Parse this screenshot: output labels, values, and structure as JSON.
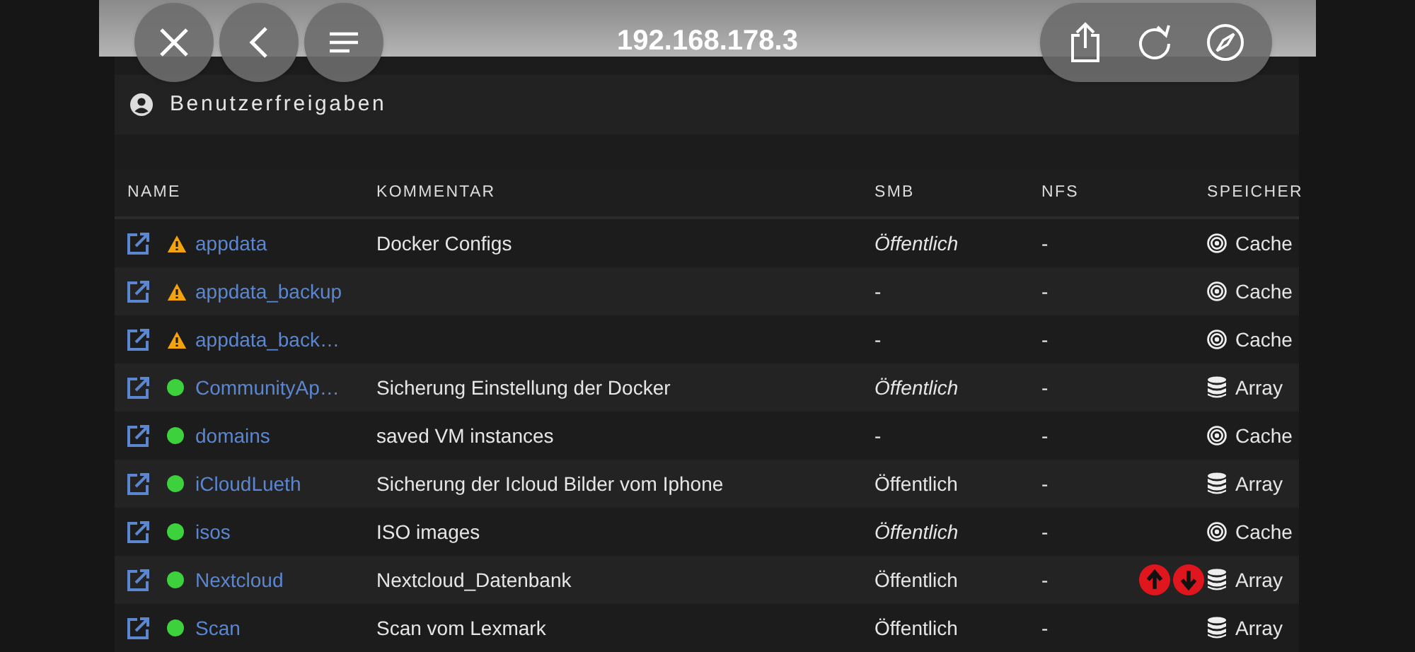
{
  "browser": {
    "url": "192.168.178.3"
  },
  "panel": {
    "title": "Benutzerfreigaben"
  },
  "table": {
    "columns": [
      "NAME",
      "KOMMENTAR",
      "SMB",
      "NFS",
      "SPEICHER"
    ],
    "rows": [
      {
        "name": "appdata",
        "status": {
          "kind": "warning"
        },
        "comment": "Docker Configs",
        "smb": "Öffentlich",
        "smb_italic": true,
        "nfs": "-",
        "storage": {
          "kind": "cache",
          "text": "Cache"
        }
      },
      {
        "name": "appdata_backup",
        "status": {
          "kind": "warning"
        },
        "smb": "-",
        "smb_italic": false,
        "nfs": "-",
        "storage": {
          "kind": "cache",
          "text": "Cache"
        }
      },
      {
        "name": "appdata_back…",
        "status": {
          "kind": "warning"
        },
        "smb": "-",
        "smb_italic": false,
        "nfs": "-",
        "storage": {
          "kind": "cache",
          "text": "Cache"
        }
      },
      {
        "name": "CommunityAp…",
        "status": {
          "kind": "ok"
        },
        "comment": "Sicherung Einstellung der Docker",
        "smb": "Öffentlich",
        "smb_italic": true,
        "nfs": "-",
        "storage": {
          "kind": "array",
          "text": "Array"
        }
      },
      {
        "name": "domains",
        "status": {
          "kind": "ok"
        },
        "comment": "saved VM instances",
        "smb": "-",
        "smb_italic": false,
        "nfs": "-",
        "storage": {
          "kind": "cache",
          "text": "Cache"
        }
      },
      {
        "name": "iCloudLueth",
        "status": {
          "kind": "ok"
        },
        "comment": "Sicherung der Icloud Bilder vom Iphone",
        "smb": "Öffentlich",
        "smb_italic": false,
        "nfs": "-",
        "storage": {
          "kind": "array",
          "text": "Array"
        }
      },
      {
        "name": "isos",
        "status": {
          "kind": "ok"
        },
        "comment": "ISO images",
        "smb": "Öffentlich",
        "smb_italic": true,
        "nfs": "-",
        "storage": {
          "kind": "cache",
          "text": "Cache"
        }
      },
      {
        "name": "Nextcloud",
        "status": {
          "kind": "ok"
        },
        "comment": "Nextcloud_Datenbank",
        "smb": "Öffentlich",
        "smb_italic": false,
        "nfs": "-",
        "storage": {
          "kind": "array",
          "text": "Array"
        },
        "transfer_badges": true
      },
      {
        "name": "Scan",
        "status": {
          "kind": "ok"
        },
        "comment": "Scan vom Lexmark",
        "smb": "Öffentlich",
        "smb_italic": false,
        "nfs": "-",
        "storage": {
          "kind": "array",
          "text": "Array"
        }
      }
    ]
  }
}
